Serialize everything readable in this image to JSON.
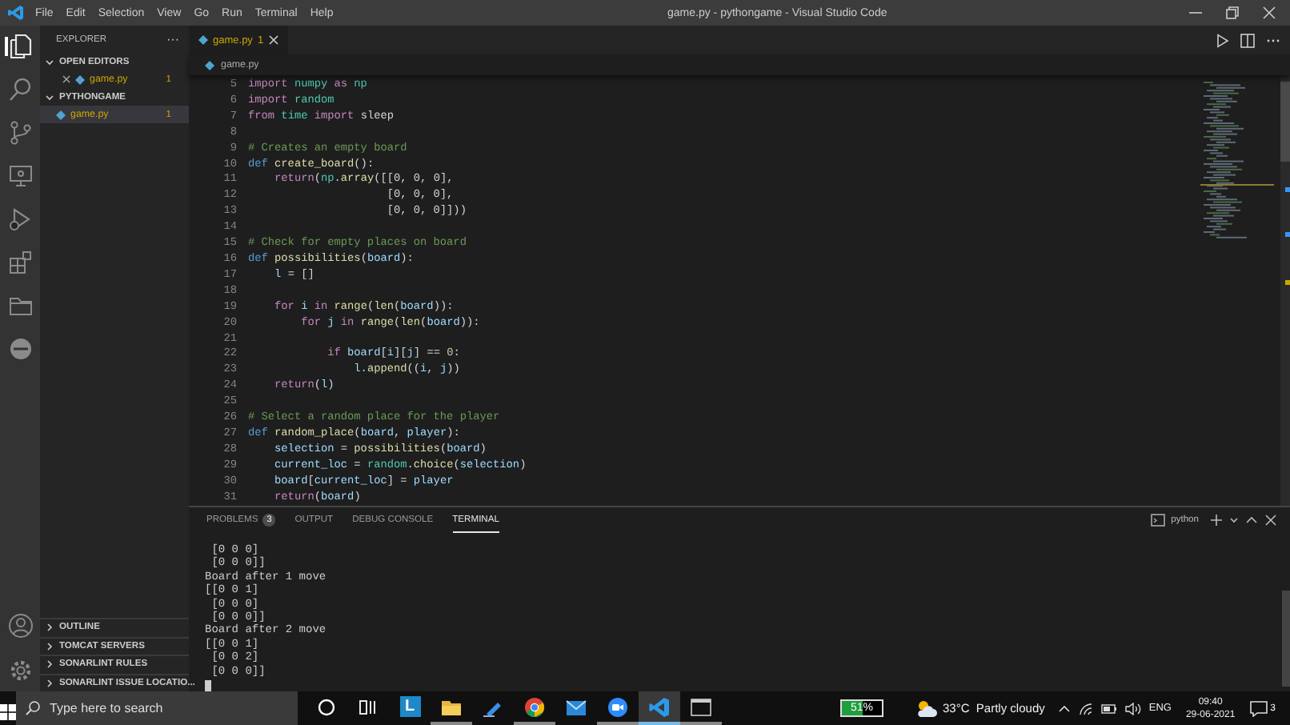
{
  "title_bar": {
    "menu": [
      "File",
      "Edit",
      "Selection",
      "View",
      "Go",
      "Run",
      "Terminal",
      "Help"
    ],
    "title": "game.py - pythongame - Visual Studio Code"
  },
  "activity_bar": {
    "items": [
      {
        "kind": "explorer",
        "selected": true
      },
      {
        "kind": "search",
        "selected": false
      },
      {
        "kind": "source-control",
        "selected": false
      },
      {
        "kind": "remote",
        "selected": false
      },
      {
        "kind": "run",
        "selected": false
      },
      {
        "kind": "extensions",
        "selected": false
      },
      {
        "kind": "folder",
        "selected": false
      },
      {
        "kind": "sonar",
        "selected": false
      }
    ],
    "bottom": [
      {
        "kind": "account"
      },
      {
        "kind": "settings"
      }
    ]
  },
  "sidebar": {
    "title": "EXPLORER",
    "more": "···",
    "sections": [
      {
        "label": "OPEN EDITORS",
        "expanded": true,
        "items": [
          {
            "name": "game.py",
            "badge": "1",
            "selected": false,
            "closable": true
          }
        ]
      },
      {
        "label": "PYTHONGAME",
        "expanded": true,
        "items": [
          {
            "name": "game.py",
            "badge": "1",
            "selected": true,
            "closable": false
          }
        ]
      }
    ],
    "bottom_sections": [
      {
        "label": "OUTLINE",
        "expanded": false
      },
      {
        "label": "TOMCAT SERVERS",
        "expanded": false
      },
      {
        "label": "SONARLINT RULES",
        "expanded": false
      },
      {
        "label": "SONARLINT ISSUE LOCATIO...",
        "expanded": false
      }
    ]
  },
  "editor": {
    "tabs": [
      {
        "name": "game.py",
        "badge": "1",
        "selected": true
      }
    ],
    "breadcrumb": "game.py",
    "lines": [
      {
        "number": "5",
        "tokens": [
          {
            "text": "import",
            "kind": "kw"
          },
          {
            "text": " numpy",
            "kind": "mod"
          },
          {
            "text": " as",
            "kind": "kw"
          },
          {
            "text": " np",
            "kind": "mod"
          }
        ]
      },
      {
        "number": "6",
        "tokens": [
          {
            "text": "import",
            "kind": "kw"
          },
          {
            "text": " random",
            "kind": "mod"
          }
        ]
      },
      {
        "number": "7",
        "tokens": [
          {
            "text": "from",
            "kind": "kw"
          },
          {
            "text": " time",
            "kind": "mod"
          },
          {
            "text": " import",
            "kind": "kw"
          },
          {
            "text": " sleep",
            "kind": "plain"
          }
        ]
      },
      {
        "number": "8"
      },
      {
        "number": "9",
        "tokens": [
          {
            "text": "# Creates an empty board",
            "kind": "comment"
          }
        ]
      },
      {
        "number": "10",
        "tokens": [
          {
            "text": "def",
            "kind": "def"
          },
          {
            "text": " create_board",
            "kind": "fn"
          },
          {
            "text": "():",
            "kind": "plain"
          }
        ]
      },
      {
        "number": "11",
        "tokens": [
          {
            "text": "    return",
            "kind": "kw"
          },
          {
            "text": "(",
            "kind": "plain"
          },
          {
            "text": "np",
            "kind": "mod"
          },
          {
            "text": ".",
            "kind": "plain"
          },
          {
            "text": "array",
            "kind": "fn"
          },
          {
            "text": "([[0, 0, 0],",
            "kind": "plain"
          }
        ]
      },
      {
        "number": "12",
        "tokens": [
          {
            "text": "                     [0, 0, 0],",
            "kind": "plain"
          }
        ]
      },
      {
        "number": "13",
        "tokens": [
          {
            "text": "                     [0, 0, 0]]))",
            "kind": "plain"
          }
        ]
      },
      {
        "number": "14"
      },
      {
        "number": "15",
        "tokens": [
          {
            "text": "# Check for empty places on board",
            "kind": "comment"
          }
        ]
      },
      {
        "number": "16",
        "tokens": [
          {
            "text": "def",
            "kind": "def"
          },
          {
            "text": " possibilities",
            "kind": "fn"
          },
          {
            "text": "(",
            "kind": "plain"
          },
          {
            "text": "board",
            "kind": "var"
          },
          {
            "text": "):",
            "kind": "plain"
          }
        ]
      },
      {
        "number": "17",
        "tokens": [
          {
            "text": "    l",
            "kind": "var"
          },
          {
            "text": " = []",
            "kind": "plain"
          }
        ]
      },
      {
        "number": "18"
      },
      {
        "number": "19",
        "tokens": [
          {
            "text": "    for",
            "kind": "kw"
          },
          {
            "text": " i",
            "kind": "var"
          },
          {
            "text": " in",
            "kind": "kw"
          },
          {
            "text": " range",
            "kind": "fn"
          },
          {
            "text": "(",
            "kind": "plain"
          },
          {
            "text": "len",
            "kind": "fn"
          },
          {
            "text": "(",
            "kind": "plain"
          },
          {
            "text": "board",
            "kind": "var"
          },
          {
            "text": ")):",
            "kind": "plain"
          }
        ]
      },
      {
        "number": "20",
        "tokens": [
          {
            "text": "        for",
            "kind": "kw"
          },
          {
            "text": " j",
            "kind": "var"
          },
          {
            "text": " in",
            "kind": "kw"
          },
          {
            "text": " range",
            "kind": "fn"
          },
          {
            "text": "(",
            "kind": "plain"
          },
          {
            "text": "len",
            "kind": "fn"
          },
          {
            "text": "(",
            "kind": "plain"
          },
          {
            "text": "board",
            "kind": "var"
          },
          {
            "text": ")):",
            "kind": "plain"
          }
        ]
      },
      {
        "number": "21"
      },
      {
        "number": "22",
        "tokens": [
          {
            "text": "            if",
            "kind": "kw"
          },
          {
            "text": " board",
            "kind": "var"
          },
          {
            "text": "[",
            "kind": "plain"
          },
          {
            "text": "i",
            "kind": "var"
          },
          {
            "text": "][",
            "kind": "plain"
          },
          {
            "text": "j",
            "kind": "var"
          },
          {
            "text": "] == ",
            "kind": "plain"
          },
          {
            "text": "0",
            "kind": "num"
          },
          {
            "text": ":",
            "kind": "plain"
          }
        ]
      },
      {
        "number": "23",
        "tokens": [
          {
            "text": "                l",
            "kind": "var"
          },
          {
            "text": ".",
            "kind": "plain"
          },
          {
            "text": "append",
            "kind": "fn"
          },
          {
            "text": "((",
            "kind": "plain"
          },
          {
            "text": "i",
            "kind": "var"
          },
          {
            "text": ", ",
            "kind": "plain"
          },
          {
            "text": "j",
            "kind": "var"
          },
          {
            "text": "))",
            "kind": "plain"
          }
        ]
      },
      {
        "number": "24",
        "tokens": [
          {
            "text": "    return",
            "kind": "kw"
          },
          {
            "text": "(",
            "kind": "plain"
          },
          {
            "text": "l",
            "kind": "var"
          },
          {
            "text": ")",
            "kind": "plain"
          }
        ]
      },
      {
        "number": "25"
      },
      {
        "number": "26",
        "tokens": [
          {
            "text": "# Select a random place for the player",
            "kind": "comment"
          }
        ]
      },
      {
        "number": "27",
        "tokens": [
          {
            "text": "def",
            "kind": "def"
          },
          {
            "text": " random_place",
            "kind": "fn"
          },
          {
            "text": "(",
            "kind": "plain"
          },
          {
            "text": "board",
            "kind": "var"
          },
          {
            "text": ", ",
            "kind": "plain"
          },
          {
            "text": "player",
            "kind": "var"
          },
          {
            "text": "):",
            "kind": "plain"
          }
        ]
      },
      {
        "number": "28",
        "tokens": [
          {
            "text": "    selection",
            "kind": "var"
          },
          {
            "text": " = ",
            "kind": "plain"
          },
          {
            "text": "possibilities",
            "kind": "fn"
          },
          {
            "text": "(",
            "kind": "plain"
          },
          {
            "text": "board",
            "kind": "var"
          },
          {
            "text": ")",
            "kind": "plain"
          }
        ]
      },
      {
        "number": "29",
        "tokens": [
          {
            "text": "    current_loc",
            "kind": "var"
          },
          {
            "text": " = ",
            "kind": "plain"
          },
          {
            "text": "random",
            "kind": "mod"
          },
          {
            "text": ".",
            "kind": "plain"
          },
          {
            "text": "choice",
            "kind": "fn"
          },
          {
            "text": "(",
            "kind": "plain"
          },
          {
            "text": "selection",
            "kind": "var"
          },
          {
            "text": ")",
            "kind": "plain"
          }
        ]
      },
      {
        "number": "30",
        "tokens": [
          {
            "text": "    board",
            "kind": "var"
          },
          {
            "text": "[",
            "kind": "plain"
          },
          {
            "text": "current_loc",
            "kind": "var"
          },
          {
            "text": "] = ",
            "kind": "plain"
          },
          {
            "text": "player",
            "kind": "var"
          }
        ]
      },
      {
        "number": "31",
        "tokens": [
          {
            "text": "    return",
            "kind": "kw"
          },
          {
            "text": "(",
            "kind": "plain"
          },
          {
            "text": "board",
            "kind": "var"
          },
          {
            "text": ")",
            "kind": "plain"
          }
        ]
      }
    ]
  },
  "panel": {
    "tabs": [
      {
        "label": "PROBLEMS",
        "count": "3",
        "selected": false
      },
      {
        "label": "OUTPUT",
        "selected": false
      },
      {
        "label": "DEBUG CONSOLE",
        "selected": false
      },
      {
        "label": "TERMINAL",
        "selected": true
      }
    ],
    "terminal_name": "python",
    "terminal_lines": [
      " [0 0 0]",
      " [0 0 0]]",
      "Board after 1 move",
      "[[0 0 1]",
      " [0 0 0]",
      " [0 0 0]]",
      "Board after 2 move",
      "[[0 0 1]",
      " [0 0 2]",
      " [0 0 0]]"
    ]
  },
  "taskbar": {
    "search_placeholder": "Type here to search",
    "apps": [
      {
        "kind": "cortana",
        "running": false,
        "active": false
      },
      {
        "kind": "task-view",
        "running": false,
        "active": false
      },
      {
        "kind": "letter",
        "label": "L",
        "running": false,
        "active": false
      },
      {
        "kind": "folder",
        "running": true,
        "active": false
      },
      {
        "kind": "pen",
        "running": false,
        "active": false
      },
      {
        "kind": "chrome",
        "running": true,
        "active": false
      },
      {
        "kind": "mail",
        "running": false,
        "active": false
      },
      {
        "kind": "video",
        "running": true,
        "active": false
      },
      {
        "kind": "vscode",
        "running": true,
        "active": true
      },
      {
        "kind": "terminal",
        "running": true,
        "active": false
      }
    ],
    "battery": {
      "level": 0.51,
      "reading": "51%"
    },
    "weather": "33°C  Partly cloudy",
    "language": "ENG",
    "time": "09:40",
    "date": "29-06-2021",
    "notifications": "3"
  }
}
